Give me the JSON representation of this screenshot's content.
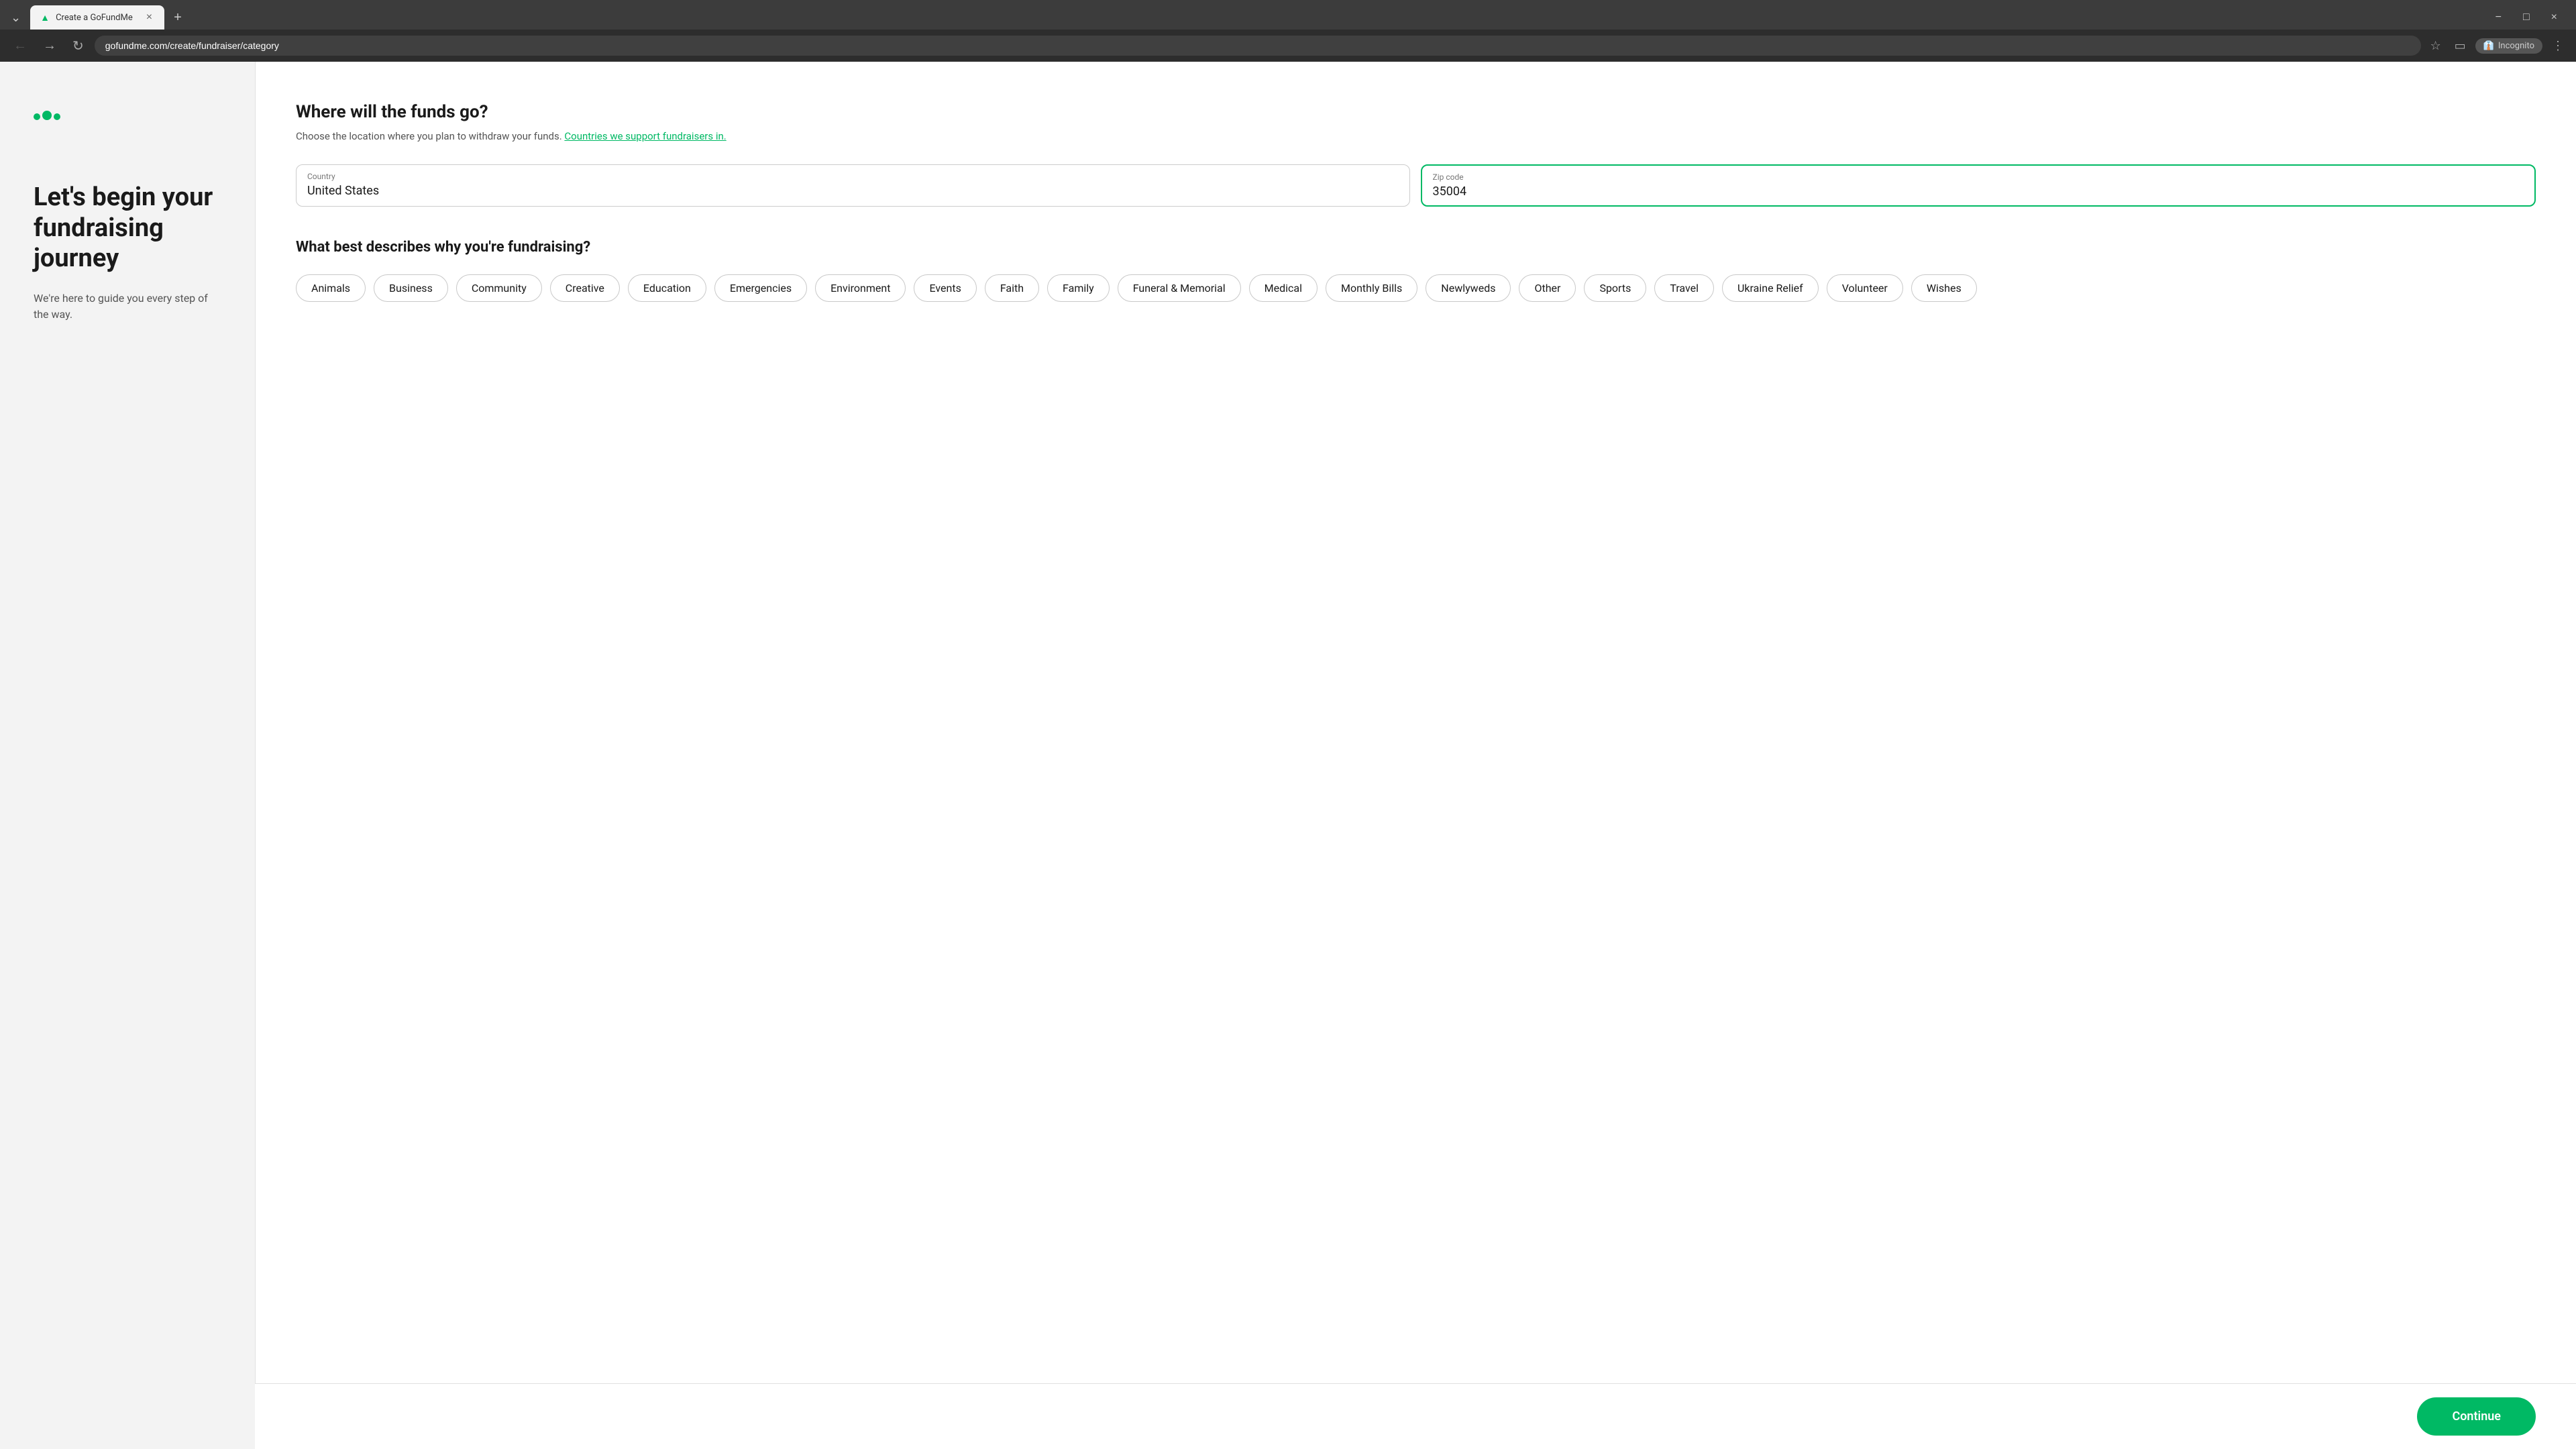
{
  "browser": {
    "tab_label": "Create a GoFundMe",
    "url": "gofundme.com/create/fundraiser/category",
    "incognito_label": "Incognito"
  },
  "left_panel": {
    "heading_line1": "Let's begin your",
    "heading_line2": "fundraising journey",
    "subtext": "We're here to guide you every step of the way."
  },
  "form": {
    "location_title": "Where will the funds go?",
    "location_desc_prefix": "Choose the location where you plan to withdraw your funds. ",
    "location_link": "Countries we support fundraisers in.",
    "country_label": "Country",
    "country_value": "United States",
    "zip_label": "Zip code",
    "zip_value": "35004",
    "category_title": "What best describes why you're fundraising?",
    "categories": [
      "Animals",
      "Business",
      "Community",
      "Creative",
      "Education",
      "Emergencies",
      "Environment",
      "Events",
      "Faith",
      "Family",
      "Funeral & Memorial",
      "Medical",
      "Monthly Bills",
      "Newlyweds",
      "Other",
      "Sports",
      "Travel",
      "Ukraine Relief",
      "Volunteer",
      "Wishes"
    ],
    "continue_label": "Continue"
  }
}
